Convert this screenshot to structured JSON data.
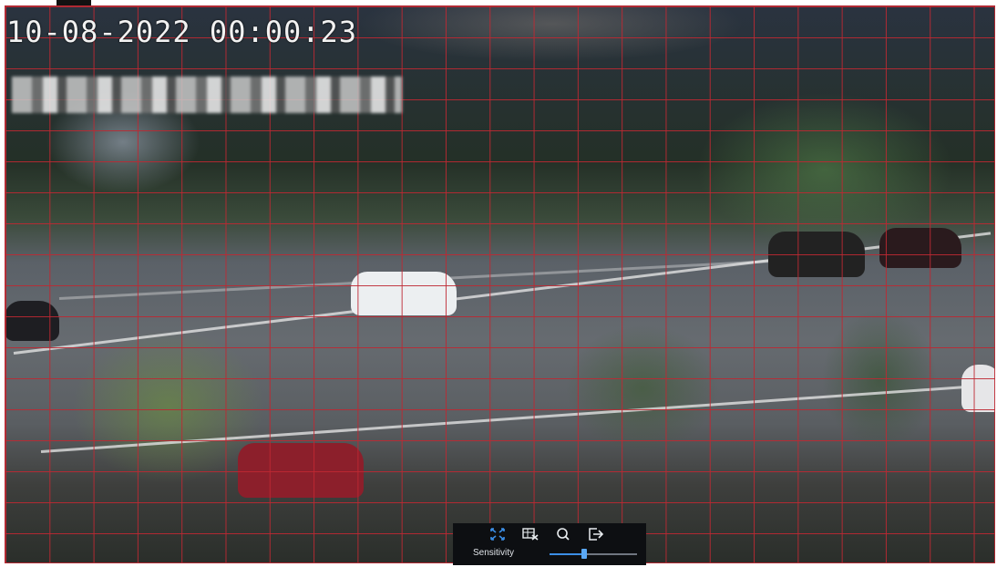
{
  "overlay": {
    "timestamp": "10-08-2022 00:00:23"
  },
  "toolbar": {
    "icons": [
      "expand-icon",
      "clear-grid-icon",
      "search-icon",
      "exit-icon"
    ],
    "sensitivity_label": "Sensitivity",
    "sensitivity_level": 0.4
  },
  "colors": {
    "grid_line": "#be2832",
    "toolbar_bg": "#0d0f12",
    "active_icon": "#3b8ee6",
    "icon": "#e8ecef"
  }
}
